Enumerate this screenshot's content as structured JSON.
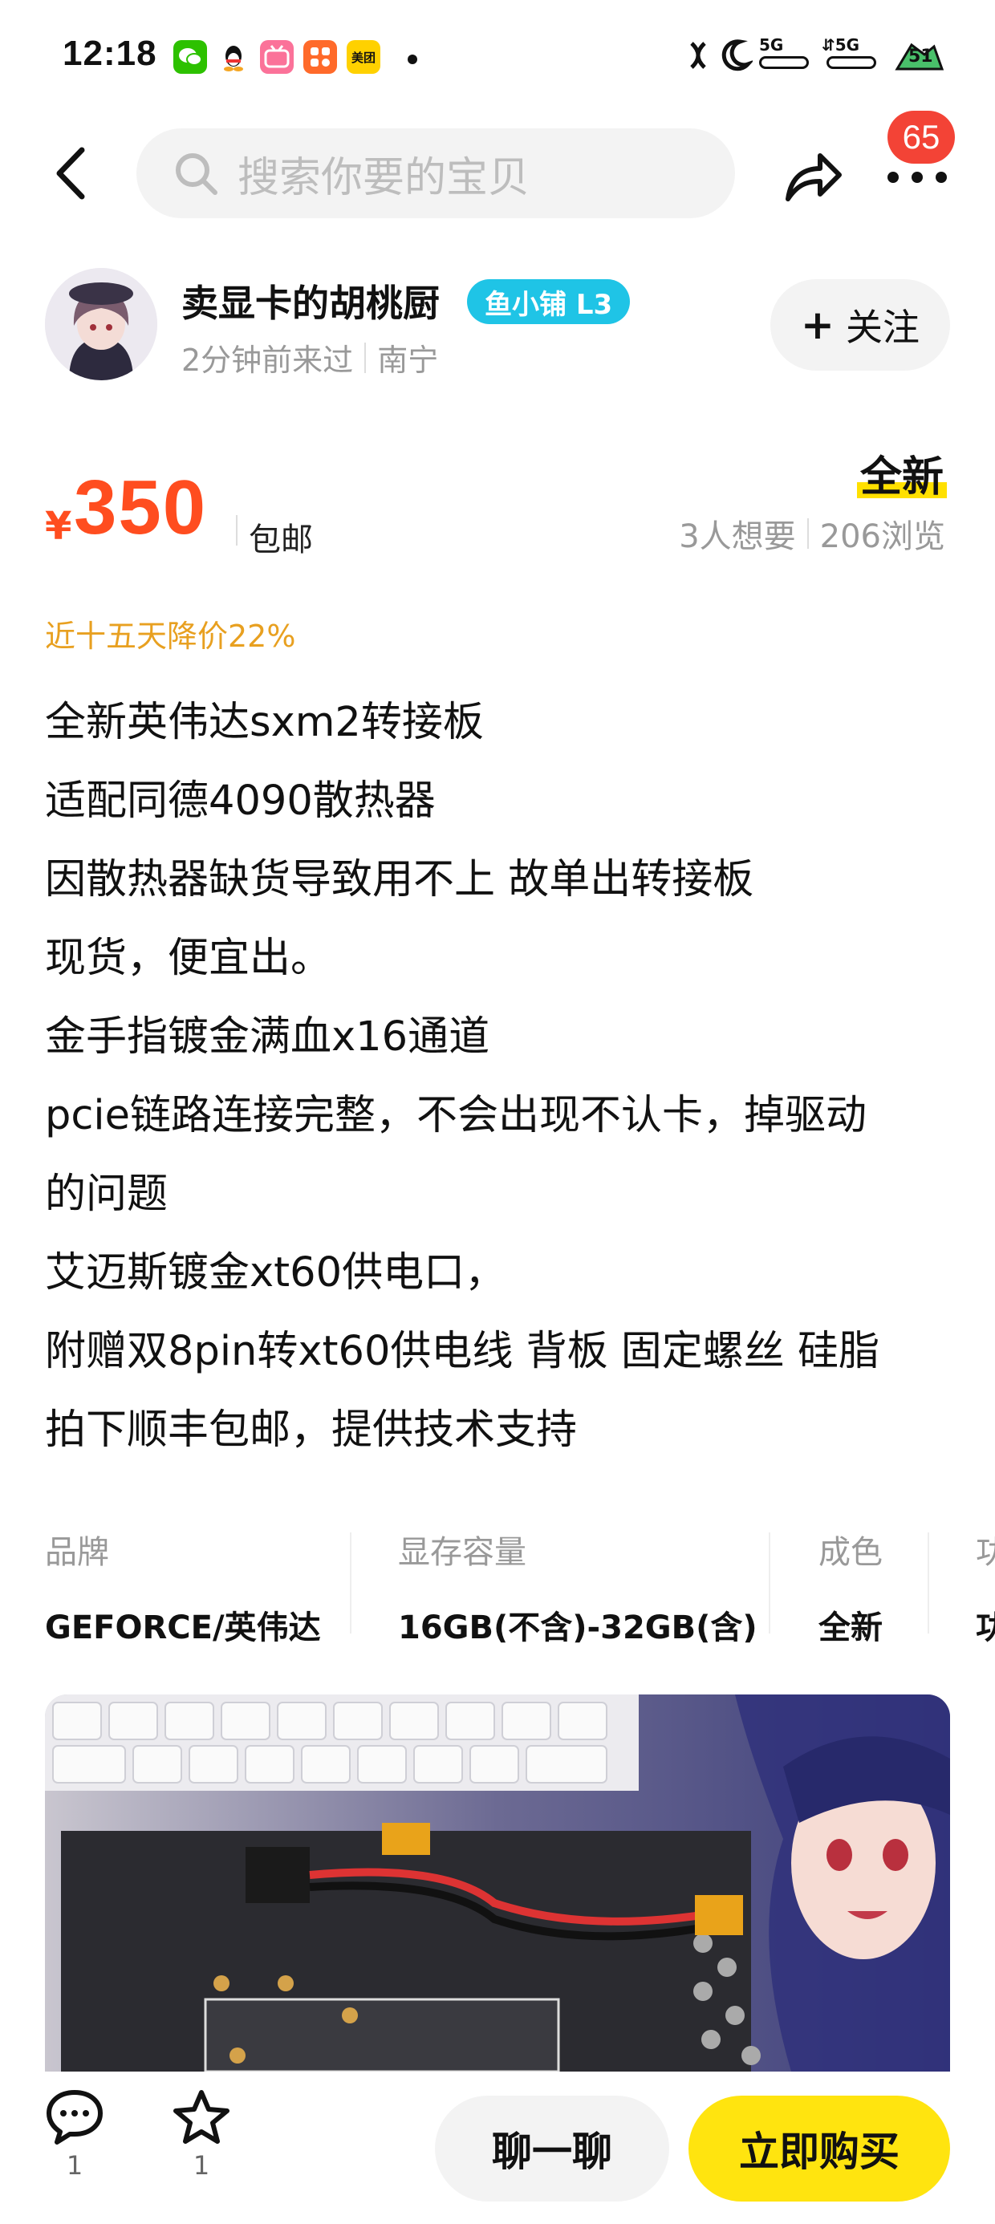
{
  "status_bar": {
    "time": "12:18",
    "app_icons": [
      {
        "name": "wechat-icon",
        "color": "#2dc100"
      },
      {
        "name": "qq-icon",
        "color": "#111111"
      },
      {
        "name": "bilibili-icon",
        "color": "#fb7299",
        "text": "bilibili"
      },
      {
        "name": "app-grid-icon",
        "color": "#ff6a2a"
      },
      {
        "name": "meituan-icon",
        "color": "#ffd100",
        "text": "美团"
      }
    ],
    "network_left": "5G",
    "network_right": "5G",
    "battery": "51"
  },
  "nav": {
    "search_placeholder": "搜索你要的宝贝",
    "message_badge": "65"
  },
  "seller": {
    "name": "卖显卡的胡桃厨",
    "badge": "鱼小铺 L3",
    "last_seen": "2分钟前来过",
    "location": "南宁",
    "follow_label": "关注"
  },
  "price": {
    "symbol": "¥",
    "value": "350",
    "shipping": "包邮",
    "condition": "全新",
    "wants": "3人想要",
    "views": "206浏览",
    "drop_note": "近十五天降价22%"
  },
  "description": [
    "全新英伟达sxm2转接板",
    "适配同德4090散热器",
    "因散热器缺货导致用不上 故单出转接板",
    "现货，便宜出。",
    "金手指镀金满血x16通道",
    "pcie链路连接完整，不会出现不认卡，掉驱动",
    "的问题",
    "艾迈斯镀金xt60供电口，",
    "附赠双8pin转xt60供电线 背板 固定螺丝 硅脂",
    "拍下顺丰包邮，提供技术支持"
  ],
  "specs": [
    {
      "key": "品牌",
      "value": "GEFORCE/英伟达"
    },
    {
      "key": "显存容量",
      "value": "16GB(不含)-32GB(含)"
    },
    {
      "key": "成色",
      "value": "全新"
    },
    {
      "key": "功",
      "value": "功"
    }
  ],
  "bottom_bar": {
    "comment_count": "1",
    "favorite_count": "1",
    "chat_label": "聊一聊",
    "buy_label": "立即购买"
  },
  "colors": {
    "price": "#ff4d1f",
    "accent_yellow": "#ffe40f",
    "badge_red": "#f34336",
    "store_badge": "#1fc4e6",
    "drop_note": "#e8a020"
  }
}
